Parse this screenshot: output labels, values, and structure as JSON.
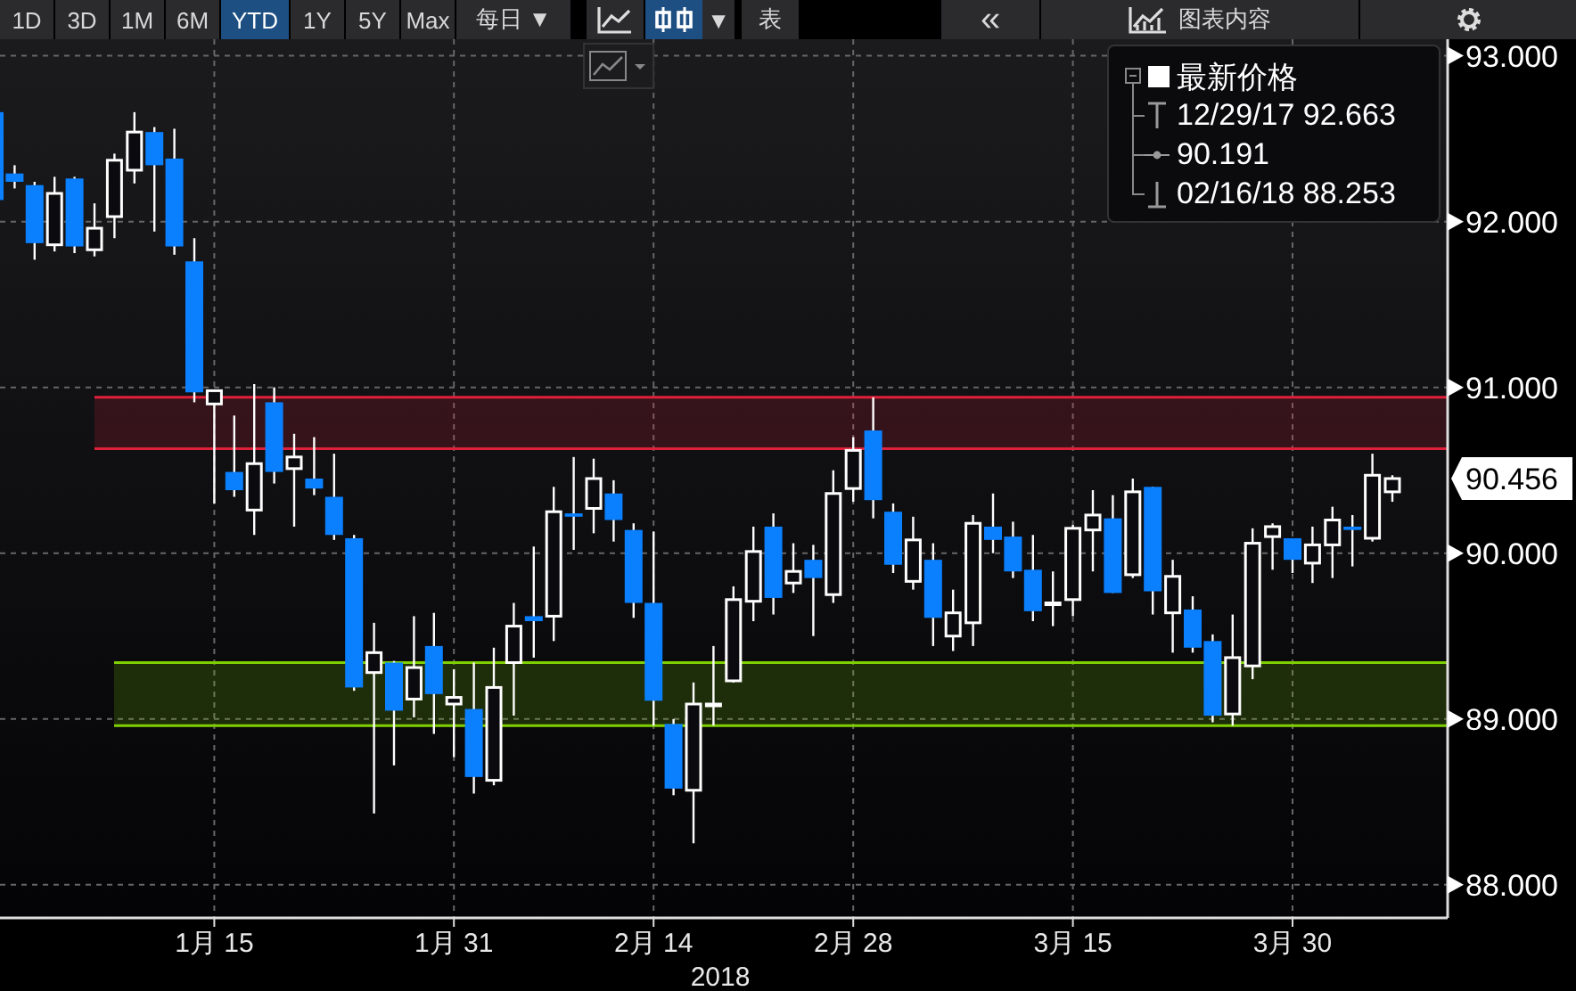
{
  "toolbar": {
    "ranges": [
      {
        "label": "1D",
        "selected": false
      },
      {
        "label": "3D",
        "selected": false
      },
      {
        "label": "1M",
        "selected": false
      },
      {
        "label": "6M",
        "selected": false
      },
      {
        "label": "YTD",
        "selected": true
      },
      {
        "label": "1Y",
        "selected": false
      },
      {
        "label": "5Y",
        "selected": false
      },
      {
        "label": "Max",
        "selected": false
      }
    ],
    "interval": {
      "label": "每日",
      "caret": "▼"
    },
    "chart_types": [
      {
        "kind": "line",
        "selected": false
      },
      {
        "kind": "candle",
        "selected": true
      }
    ],
    "type_caret": "▼",
    "table_button": "表",
    "collapse_button": "«",
    "contents_button": "图表内容"
  },
  "legend": {
    "title": "最新价格",
    "rows": [
      {
        "kind": "high",
        "text": "12/29/17 92.663"
      },
      {
        "kind": "average",
        "text": "90.191"
      },
      {
        "kind": "low",
        "text": "02/16/18 88.253"
      }
    ]
  },
  "price_label": "90.456",
  "year_label": "2018",
  "chart_data": {
    "type": "candlestick",
    "ylim": [
      87.8,
      93.1
    ],
    "yticks": [
      {
        "value": 88,
        "label": "88.000"
      },
      {
        "value": 89,
        "label": "89.000"
      },
      {
        "value": 90,
        "label": "90.000"
      },
      {
        "value": 91,
        "label": "91.000"
      },
      {
        "value": 92,
        "label": "92.000"
      },
      {
        "value": 93,
        "label": "93.000"
      }
    ],
    "categories": [
      null,
      null,
      null,
      null,
      null,
      null,
      null,
      null,
      null,
      null,
      null,
      "1月 15",
      null,
      null,
      null,
      null,
      null,
      null,
      null,
      null,
      null,
      null,
      null,
      "1月 31",
      null,
      null,
      null,
      null,
      null,
      null,
      null,
      null,
      null,
      "2月 14",
      null,
      null,
      null,
      null,
      null,
      null,
      null,
      null,
      null,
      "2月 28",
      null,
      null,
      null,
      null,
      null,
      null,
      null,
      null,
      null,
      null,
      "3月 15",
      null,
      null,
      null,
      null,
      null,
      null,
      null,
      null,
      null,
      null,
      "3月 30",
      null,
      null,
      null,
      null,
      null
    ],
    "ohlc": [
      [
        92.66,
        92.66,
        92.13,
        92.13
      ],
      [
        92.29,
        92.34,
        92.2,
        92.24
      ],
      [
        92.22,
        92.24,
        91.77,
        91.87
      ],
      [
        91.86,
        92.27,
        91.82,
        92.17
      ],
      [
        92.26,
        92.27,
        91.81,
        91.85
      ],
      [
        91.83,
        92.11,
        91.79,
        91.96
      ],
      [
        92.03,
        92.41,
        91.9,
        92.37
      ],
      [
        92.31,
        92.66,
        92.23,
        92.54
      ],
      [
        92.54,
        92.57,
        91.94,
        92.34
      ],
      [
        92.38,
        92.56,
        91.8,
        91.85
      ],
      [
        91.76,
        91.9,
        90.91,
        90.97
      ],
      [
        90.9,
        90.98,
        90.3,
        90.98
      ],
      [
        90.49,
        90.83,
        90.34,
        90.38
      ],
      [
        90.26,
        91.02,
        90.11,
        90.54
      ],
      [
        90.91,
        91.0,
        90.42,
        90.49
      ],
      [
        90.51,
        90.72,
        90.16,
        90.58
      ],
      [
        90.45,
        90.7,
        90.35,
        90.39
      ],
      [
        90.34,
        90.6,
        90.08,
        90.11
      ],
      [
        90.09,
        90.11,
        89.17,
        89.19
      ],
      [
        89.28,
        89.58,
        88.43,
        89.4
      ],
      [
        89.34,
        89.35,
        88.72,
        89.05
      ],
      [
        89.12,
        89.62,
        89.01,
        89.31
      ],
      [
        89.44,
        89.64,
        88.91,
        89.15
      ],
      [
        89.09,
        89.3,
        88.77,
        89.13
      ],
      [
        89.06,
        89.34,
        88.55,
        88.65
      ],
      [
        88.63,
        89.43,
        88.6,
        89.19
      ],
      [
        89.34,
        89.7,
        89.02,
        89.56
      ],
      [
        89.62,
        90.04,
        89.37,
        89.59
      ],
      [
        89.62,
        90.4,
        89.47,
        90.25
      ],
      [
        90.24,
        90.58,
        90.02,
        90.22
      ],
      [
        90.27,
        90.57,
        90.12,
        90.45
      ],
      [
        90.36,
        90.44,
        90.07,
        90.2
      ],
      [
        90.14,
        90.18,
        89.61,
        89.7
      ],
      [
        89.7,
        90.13,
        88.96,
        89.11
      ],
      [
        88.97,
        89.0,
        88.54,
        88.58
      ],
      [
        88.57,
        89.22,
        88.25,
        89.09
      ],
      [
        89.09,
        89.44,
        88.96,
        89.09
      ],
      [
        89.23,
        89.8,
        89.22,
        89.72
      ],
      [
        89.71,
        90.16,
        89.59,
        90.01
      ],
      [
        90.16,
        90.24,
        89.63,
        89.73
      ],
      [
        89.82,
        90.06,
        89.76,
        89.89
      ],
      [
        89.96,
        90.05,
        89.5,
        89.85
      ],
      [
        89.75,
        90.5,
        89.7,
        90.36
      ],
      [
        90.39,
        90.7,
        90.31,
        90.62
      ],
      [
        90.74,
        90.94,
        90.21,
        90.32
      ],
      [
        90.25,
        90.3,
        89.88,
        89.93
      ],
      [
        89.83,
        90.22,
        89.78,
        90.08
      ],
      [
        89.96,
        90.06,
        89.44,
        89.61
      ],
      [
        89.5,
        89.78,
        89.41,
        89.64
      ],
      [
        89.58,
        90.23,
        89.44,
        90.18
      ],
      [
        90.16,
        90.36,
        90.0,
        90.08
      ],
      [
        90.1,
        90.19,
        89.85,
        89.89
      ],
      [
        89.9,
        90.11,
        89.59,
        89.65
      ],
      [
        89.7,
        89.89,
        89.56,
        89.7
      ],
      [
        89.72,
        90.17,
        89.62,
        90.15
      ],
      [
        90.14,
        90.38,
        89.89,
        90.23
      ],
      [
        90.21,
        90.35,
        89.76,
        89.76
      ],
      [
        89.87,
        90.45,
        89.85,
        90.37
      ],
      [
        90.4,
        90.4,
        89.63,
        89.77
      ],
      [
        89.64,
        89.96,
        89.4,
        89.86
      ],
      [
        89.66,
        89.74,
        89.4,
        89.43
      ],
      [
        89.47,
        89.51,
        88.98,
        89.02
      ],
      [
        89.03,
        89.63,
        88.96,
        89.37
      ],
      [
        89.32,
        90.15,
        89.24,
        90.06
      ],
      [
        90.1,
        90.18,
        89.9,
        90.16
      ],
      [
        90.09,
        90.09,
        89.88,
        89.96
      ],
      [
        89.94,
        90.16,
        89.82,
        90.05
      ],
      [
        90.05,
        90.28,
        89.85,
        90.2
      ],
      [
        90.16,
        90.23,
        89.92,
        90.14
      ],
      [
        90.09,
        90.6,
        90.07,
        90.47
      ],
      [
        90.37,
        90.47,
        90.31,
        90.45
      ]
    ],
    "grid": true,
    "ref_lines": [
      {
        "axis": "y",
        "value": 90.94,
        "color": "#e0203a"
      },
      {
        "axis": "y",
        "value": 90.63,
        "color": "#e0203a"
      },
      {
        "axis": "y",
        "value": 89.34,
        "color": "#7fd000"
      },
      {
        "axis": "y",
        "value": 88.96,
        "color": "#7fd000"
      }
    ]
  }
}
